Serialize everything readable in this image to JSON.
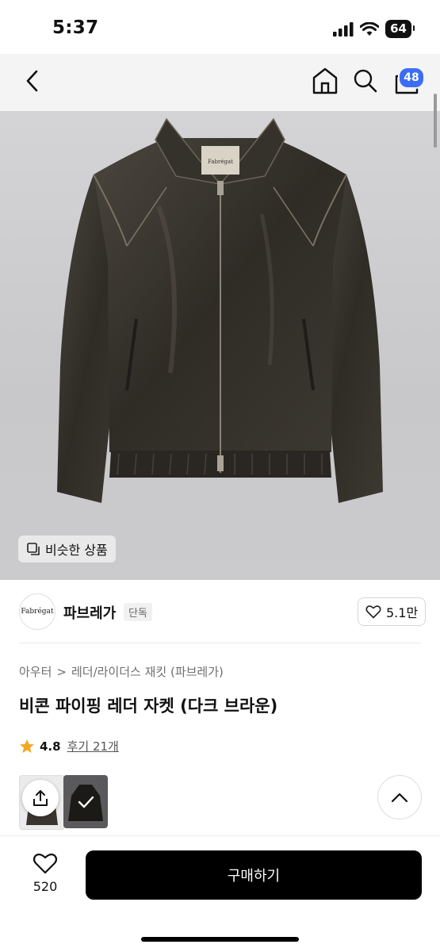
{
  "status_bar": {
    "time": "5:37",
    "battery": "64"
  },
  "nav": {
    "cart_count": "48"
  },
  "hero": {
    "similar_label": "비슷한 상품",
    "jacket_label": "Fabrégat"
  },
  "brand": {
    "logo_text": "Fabrégat",
    "name": "파브레가",
    "tag": "단독",
    "likes": "5.1만"
  },
  "product": {
    "breadcrumb": [
      "아우터",
      "레더/라이더스 재킷 (파브레가)"
    ],
    "breadcrumb_sep": ">",
    "title": "비콘 파이핑 레더 자켓 (다크 브라운)",
    "rating": "4.8",
    "reviews": "후기 21개"
  },
  "bottom": {
    "wish_count": "520",
    "buy_label": "구매하기"
  },
  "colors": {
    "accent_badge": "#3b6ef5",
    "star": "#f5a623",
    "buy_bg": "#000000"
  },
  "icons": [
    "back-icon",
    "home-icon",
    "search-icon",
    "cart-icon",
    "similar-icon",
    "heart-icon",
    "star-icon",
    "share-icon",
    "chevron-up-icon",
    "check-icon"
  ]
}
